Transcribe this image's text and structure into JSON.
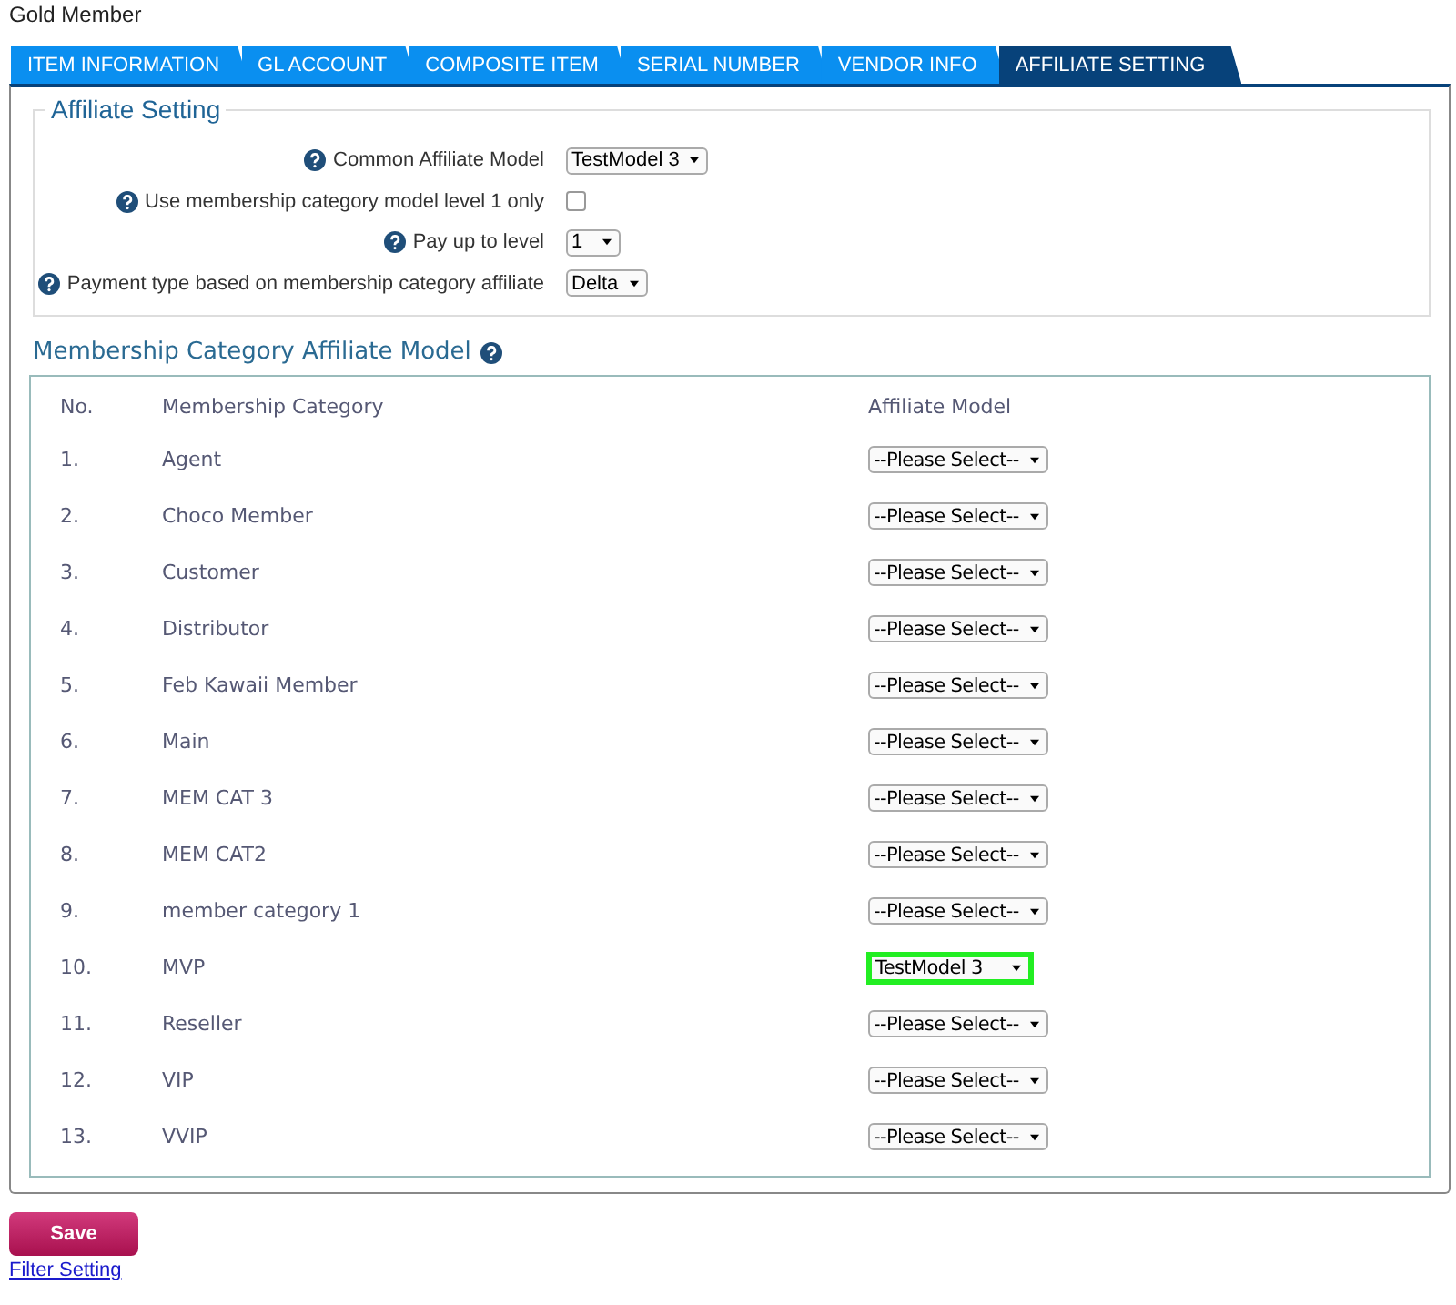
{
  "page_title": "Gold Member",
  "tabs": [
    {
      "label": "ITEM INFORMATION",
      "selected": false
    },
    {
      "label": "GL ACCOUNT",
      "selected": false
    },
    {
      "label": "COMPOSITE ITEM",
      "selected": false
    },
    {
      "label": "SERIAL NUMBER",
      "selected": false
    },
    {
      "label": "VENDOR INFO",
      "selected": false
    },
    {
      "label": "AFFILIATE SETTING",
      "selected": true
    }
  ],
  "affiliate_setting": {
    "legend": "Affiliate Setting",
    "fields": [
      {
        "kind": "select",
        "label": "Common Affiliate Model",
        "value": "TestModel 3"
      },
      {
        "kind": "checkbox",
        "label": "Use membership category model level 1 only",
        "checked": false
      },
      {
        "kind": "select",
        "label": "Pay up to level",
        "value": "1"
      },
      {
        "kind": "select",
        "label": "Payment type based on membership category affiliate",
        "value": "Delta"
      }
    ]
  },
  "membership_section": {
    "heading": "Membership Category Affiliate Model",
    "columns": [
      "No.",
      "Membership Category",
      "Affiliate Model"
    ],
    "rows": [
      {
        "no": "1.",
        "category": "Agent",
        "model": "--Please Select--",
        "highlighted": false
      },
      {
        "no": "2.",
        "category": "Choco Member",
        "model": "--Please Select--",
        "highlighted": false
      },
      {
        "no": "3.",
        "category": "Customer",
        "model": "--Please Select--",
        "highlighted": false
      },
      {
        "no": "4.",
        "category": "Distributor",
        "model": "--Please Select--",
        "highlighted": false
      },
      {
        "no": "5.",
        "category": "Feb Kawaii Member",
        "model": "--Please Select--",
        "highlighted": false
      },
      {
        "no": "6.",
        "category": "Main",
        "model": "--Please Select--",
        "highlighted": false
      },
      {
        "no": "7.",
        "category": "MEM CAT 3",
        "model": "--Please Select--",
        "highlighted": false
      },
      {
        "no": "8.",
        "category": "MEM CAT2",
        "model": "--Please Select--",
        "highlighted": false
      },
      {
        "no": "9.",
        "category": "member category 1",
        "model": "--Please Select--",
        "highlighted": false
      },
      {
        "no": "10.",
        "category": "MVP",
        "model": "TestModel 3",
        "highlighted": true
      },
      {
        "no": "11.",
        "category": "Reseller",
        "model": "--Please Select--",
        "highlighted": false
      },
      {
        "no": "12.",
        "category": "VIP",
        "model": "--Please Select--",
        "highlighted": false
      },
      {
        "no": "13.",
        "category": "VVIP",
        "model": "--Please Select--",
        "highlighted": false
      }
    ]
  },
  "save_button": "Save",
  "filter_link": "Filter Setting"
}
